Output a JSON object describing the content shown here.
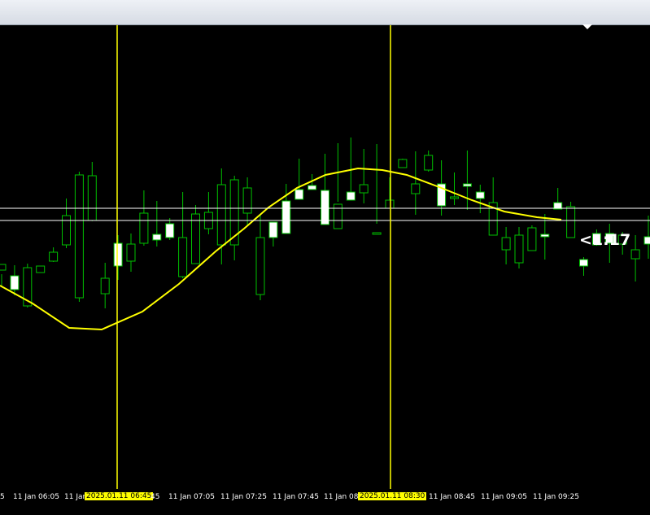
{
  "countdown": "<1:17",
  "colors": {
    "background": "#000000",
    "up_candle": "#ffffff",
    "candle_outline": "#00c000",
    "moving_average": "#ffff00",
    "crosshair": "#ffff00",
    "price_line": "#ffffff"
  },
  "chart_data": {
    "type": "candlestick",
    "x_ticks": [
      "5",
      "11 Jan 06:05",
      "11 Jan",
      "",
      "45",
      "11 Jan 07:05",
      "11 Jan 07:25",
      "11 Jan 07:45",
      "11 Jan 08",
      "",
      "11 Jan 08:45",
      "11 Jan 09:05",
      "11 Jan 09:25"
    ],
    "crosshair_labels": [
      "2025.01.11 06:45",
      "2025.01.11 08:30"
    ],
    "y_range": [
      0,
      570
    ],
    "candles": [
      [
        269,
        276,
        250,
        264
      ],
      [
        262,
        245,
        238,
        275
      ],
      [
        225,
        272,
        223,
        277
      ],
      [
        266,
        274,
        266,
        274
      ],
      [
        280,
        291,
        279,
        297
      ],
      [
        300,
        336,
        296,
        357
      ],
      [
        235,
        386,
        230,
        390
      ],
      [
        330,
        385,
        329,
        402
      ],
      [
        240,
        259,
        222,
        278
      ],
      [
        302,
        274,
        257,
        312
      ],
      [
        280,
        301,
        267,
        314
      ],
      [
        302,
        339,
        299,
        367
      ],
      [
        313,
        306,
        298,
        354
      ],
      [
        326,
        309,
        306,
        333
      ],
      [
        261,
        309,
        259,
        365
      ],
      [
        277,
        338,
        277,
        349
      ],
      [
        320,
        340,
        313,
        365
      ],
      [
        300,
        374,
        276,
        394
      ],
      [
        300,
        380,
        281,
        385
      ],
      [
        339,
        370,
        324,
        383
      ],
      [
        239,
        309,
        232,
        338
      ],
      [
        328,
        309,
        298,
        322
      ],
      [
        354,
        314,
        354,
        375
      ],
      [
        368,
        356,
        356,
        406
      ],
      [
        373,
        368,
        368,
        387
      ],
      [
        367,
        325,
        340,
        412
      ],
      [
        320,
        350,
        353,
        425
      ],
      [
        365,
        355,
        355,
        432
      ],
      [
        364,
        374,
        351,
        418
      ],
      [
        313,
        315,
        326,
        424
      ],
      [
        345,
        355,
        355,
        383
      ],
      [
        395,
        405,
        406,
        405
      ],
      [
        363,
        375,
        337,
        415
      ],
      [
        392,
        410,
        390,
        416
      ],
      [
        375,
        348,
        336,
        404
      ],
      [
        357,
        359,
        349,
        389
      ],
      [
        375,
        372,
        343,
        416
      ],
      [
        365,
        357,
        339,
        374
      ],
      [
        312,
        352,
        337,
        383
      ],
      [
        294,
        309,
        276,
        322
      ],
      [
        278,
        312,
        271,
        322
      ],
      [
        293,
        321,
        305,
        324
      ],
      [
        313,
        310,
        282,
        338
      ],
      [
        352,
        344,
        344,
        370
      ],
      [
        309,
        347,
        346,
        353
      ],
      [
        282,
        274,
        262,
        285
      ],
      [
        314,
        300,
        299,
        319
      ],
      [
        314,
        302,
        278,
        326
      ],
      [
        301,
        312,
        288,
        316
      ],
      [
        283,
        294,
        255,
        312
      ],
      [
        310,
        301,
        283,
        336
      ],
      [
        312,
        335,
        330,
        361
      ]
    ],
    "moving_average": [
      [
        0,
        250
      ],
      [
        40,
        228
      ],
      [
        85,
        198
      ],
      [
        125,
        196
      ],
      [
        175,
        218
      ],
      [
        220,
        252
      ],
      [
        265,
        292
      ],
      [
        300,
        320
      ],
      [
        330,
        346
      ],
      [
        365,
        370
      ],
      [
        400,
        386
      ],
      [
        440,
        394
      ],
      [
        470,
        392
      ],
      [
        500,
        386
      ],
      [
        540,
        371
      ],
      [
        580,
        355
      ],
      [
        620,
        341
      ],
      [
        660,
        334
      ],
      [
        690,
        331
      ]
    ],
    "horizontal_levels": [
      330,
      345
    ],
    "grid": false
  }
}
